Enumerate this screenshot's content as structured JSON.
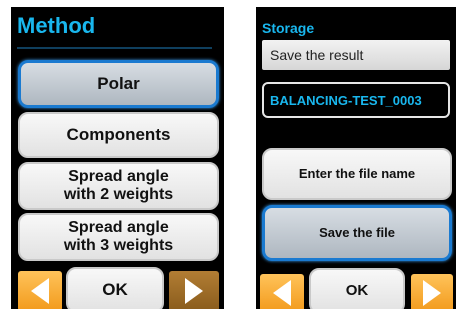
{
  "left_screen": {
    "title": "Method",
    "options": [
      {
        "label": "Polar",
        "selected": true
      },
      {
        "label": "Components",
        "selected": false
      },
      {
        "label": "Spread angle with 2 weights",
        "line1": "Spread angle",
        "line2": "with 2 weights",
        "selected": false
      },
      {
        "label": "Spread angle with 3 weights",
        "line1": "Spread angle",
        "line2": "with 3 weights",
        "selected": false
      }
    ],
    "nav": {
      "prev_icon": "left-arrow-icon",
      "ok_label": "OK",
      "next_icon": "right-arrow-icon"
    }
  },
  "right_screen": {
    "title": "Storage",
    "header": "Save the result",
    "filename_value": "BALANCING-TEST_0003",
    "enter_name_label": "Enter the file name",
    "save_label": "Save the file",
    "nav": {
      "prev_icon": "left-arrow-icon",
      "ok_label": "OK",
      "next_icon": "right-arrow-icon"
    }
  },
  "colors": {
    "accent_cyan": "#19b7ee",
    "selection_blue": "#1a7ad0",
    "nav_orange": "#f29a1c",
    "nav_orange_dark": "#8a5c1c",
    "screen_bg": "#000000"
  }
}
